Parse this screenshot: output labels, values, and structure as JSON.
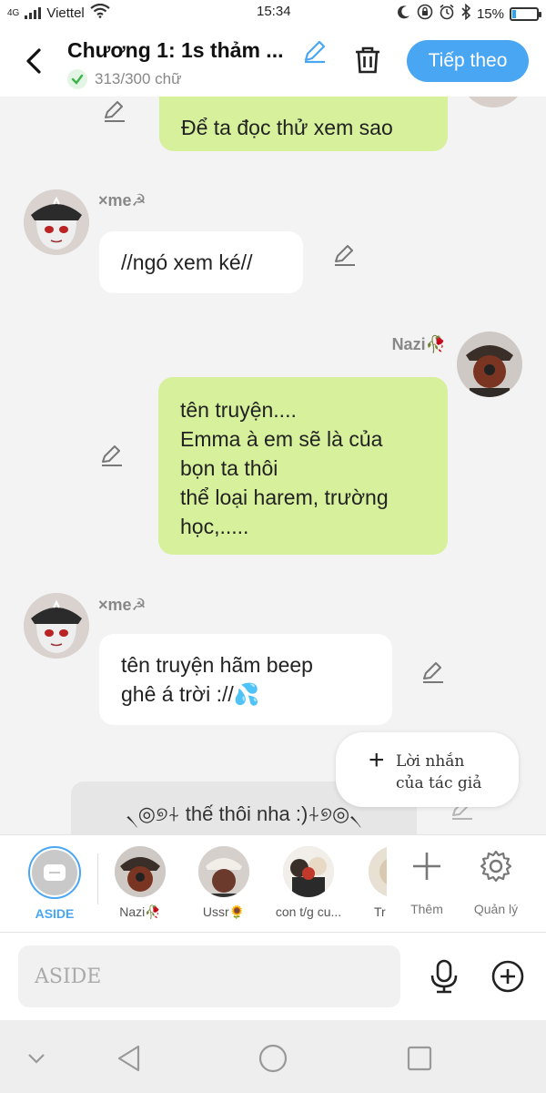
{
  "status_bar": {
    "carrier": "Viettel",
    "network": "4G",
    "time": "15:34",
    "battery": "15%",
    "battery_level": 0.15
  },
  "header": {
    "title": "Chương 1: 1s thảm ...",
    "word_count": "313/300 chữ",
    "next_label": "Tiếp theo"
  },
  "messages": [
    {
      "side": "right",
      "text_lines": [
        "Để ta đọc thử xem sao"
      ]
    },
    {
      "side": "left",
      "sender": "×me☭",
      "text_lines": [
        "//ngó xem ké//"
      ]
    },
    {
      "side": "right",
      "sender": "Nazi🥀",
      "text_lines": [
        "tên truyện....",
        "Emma à em sẽ là của",
        "bọn ta thôi",
        "thể loại harem, trường",
        "học,....."
      ]
    },
    {
      "side": "left",
      "sender": "×me☭",
      "text_lines": [
        "tên truyện hãm beep",
        "ghê á trời ://💦"
      ]
    },
    {
      "side": "aside",
      "text_lines": [
        "৲◎୭⍭ thế thôi nha :)⍭୭◎৲"
      ]
    }
  ],
  "author_note": {
    "plus": "+",
    "label_line1": "Lời nhắn",
    "label_line2": "của tác giả"
  },
  "characters": [
    {
      "name": "ASIDE"
    },
    {
      "name": "Nazi🥀"
    },
    {
      "name": "Ussr🌻"
    },
    {
      "name": "con t/g cu..."
    },
    {
      "name": "Tr"
    }
  ],
  "tools": {
    "add_label": "Thêm",
    "manage_label": "Quản lý"
  },
  "input": {
    "placeholder": "ASIDE"
  },
  "colors": {
    "accent": "#49a6f3",
    "green_bubble": "#d6f09b",
    "white_bubble": "#ffffff",
    "background": "#f3f3f3"
  }
}
